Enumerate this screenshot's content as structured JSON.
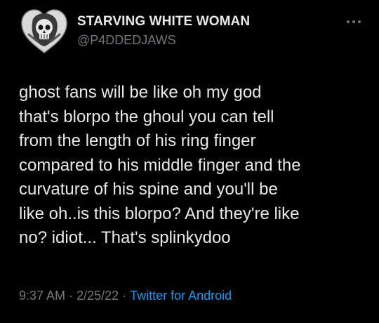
{
  "author": {
    "display_name": "STARVING WHITE WOMAN",
    "handle": "@P4DDEDJAWS",
    "avatar_icon": "heart-skull-avatar-icon"
  },
  "menu": {
    "icon": "more-horizontal-icon"
  },
  "tweet": {
    "text": "ghost fans will be like oh my god\nthat's blorpo the ghoul you can tell\nfrom the length of his ring finger\ncompared to his middle finger and the\ncurvature of his spine and you'll be\nlike oh..is this blorpo? And they're like\nno? idiot... That's splinkydoo",
    "time": "9:37 AM",
    "date": "2/25/22",
    "separator": "·",
    "source": "Twitter for Android"
  },
  "colors": {
    "background": "#000000",
    "primary_text": "#e7e9ea",
    "secondary_text": "#71767b",
    "link": "#1d9bf0"
  }
}
